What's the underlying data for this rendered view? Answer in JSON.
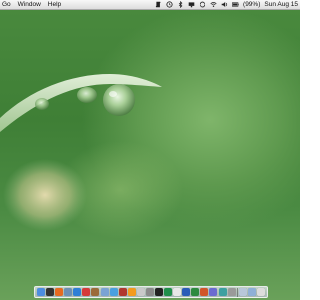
{
  "menubar": {
    "items": [
      {
        "label": "Go",
        "name": "menu-go"
      },
      {
        "label": "Window",
        "name": "menu-window"
      },
      {
        "label": "Help",
        "name": "menu-help"
      }
    ],
    "status": {
      "battery_text": "(99%)",
      "clock_text": "Sun Aug 15"
    }
  },
  "dock": {
    "apps": [
      {
        "name": "finder-icon",
        "color": "#4c8de0"
      },
      {
        "name": "dashboard-icon",
        "color": "#333333"
      },
      {
        "name": "firefox-icon",
        "color": "#e66a1f"
      },
      {
        "name": "mail-icon",
        "color": "#6c8fb5"
      },
      {
        "name": "safari-icon",
        "color": "#2f7fd6"
      },
      {
        "name": "ical-icon",
        "color": "#d63a3a"
      },
      {
        "name": "addressbook-icon",
        "color": "#9b6b3a"
      },
      {
        "name": "iphoto-icon",
        "color": "#7aa3d4"
      },
      {
        "name": "itunes-icon",
        "color": "#4aa0e0"
      },
      {
        "name": "photobooth-icon",
        "color": "#b0382f"
      },
      {
        "name": "vlc-icon",
        "color": "#f39b1e"
      },
      {
        "name": "preview-icon",
        "color": "#c9c9c9"
      },
      {
        "name": "systemprefs-icon",
        "color": "#8a8a8a"
      },
      {
        "name": "terminal-icon",
        "color": "#222222"
      },
      {
        "name": "activity-monitor-icon",
        "color": "#1f8f4a"
      },
      {
        "name": "textedit-icon",
        "color": "#e8e8e8"
      },
      {
        "name": "word-icon",
        "color": "#2a5cb8"
      },
      {
        "name": "excel-icon",
        "color": "#2c8a3f"
      },
      {
        "name": "powerpoint-icon",
        "color": "#d1552a"
      },
      {
        "name": "app-icon-20",
        "color": "#6b6bd1"
      },
      {
        "name": "app-icon-21",
        "color": "#3da0a0"
      },
      {
        "name": "app-icon-22",
        "color": "#9a9a9a"
      }
    ],
    "trailing": [
      {
        "name": "documents-stack-icon",
        "color": "#b8c7d9"
      },
      {
        "name": "downloads-stack-icon",
        "color": "#8fb0d6"
      },
      {
        "name": "trash-icon",
        "color": "#dcdcdc"
      }
    ]
  }
}
